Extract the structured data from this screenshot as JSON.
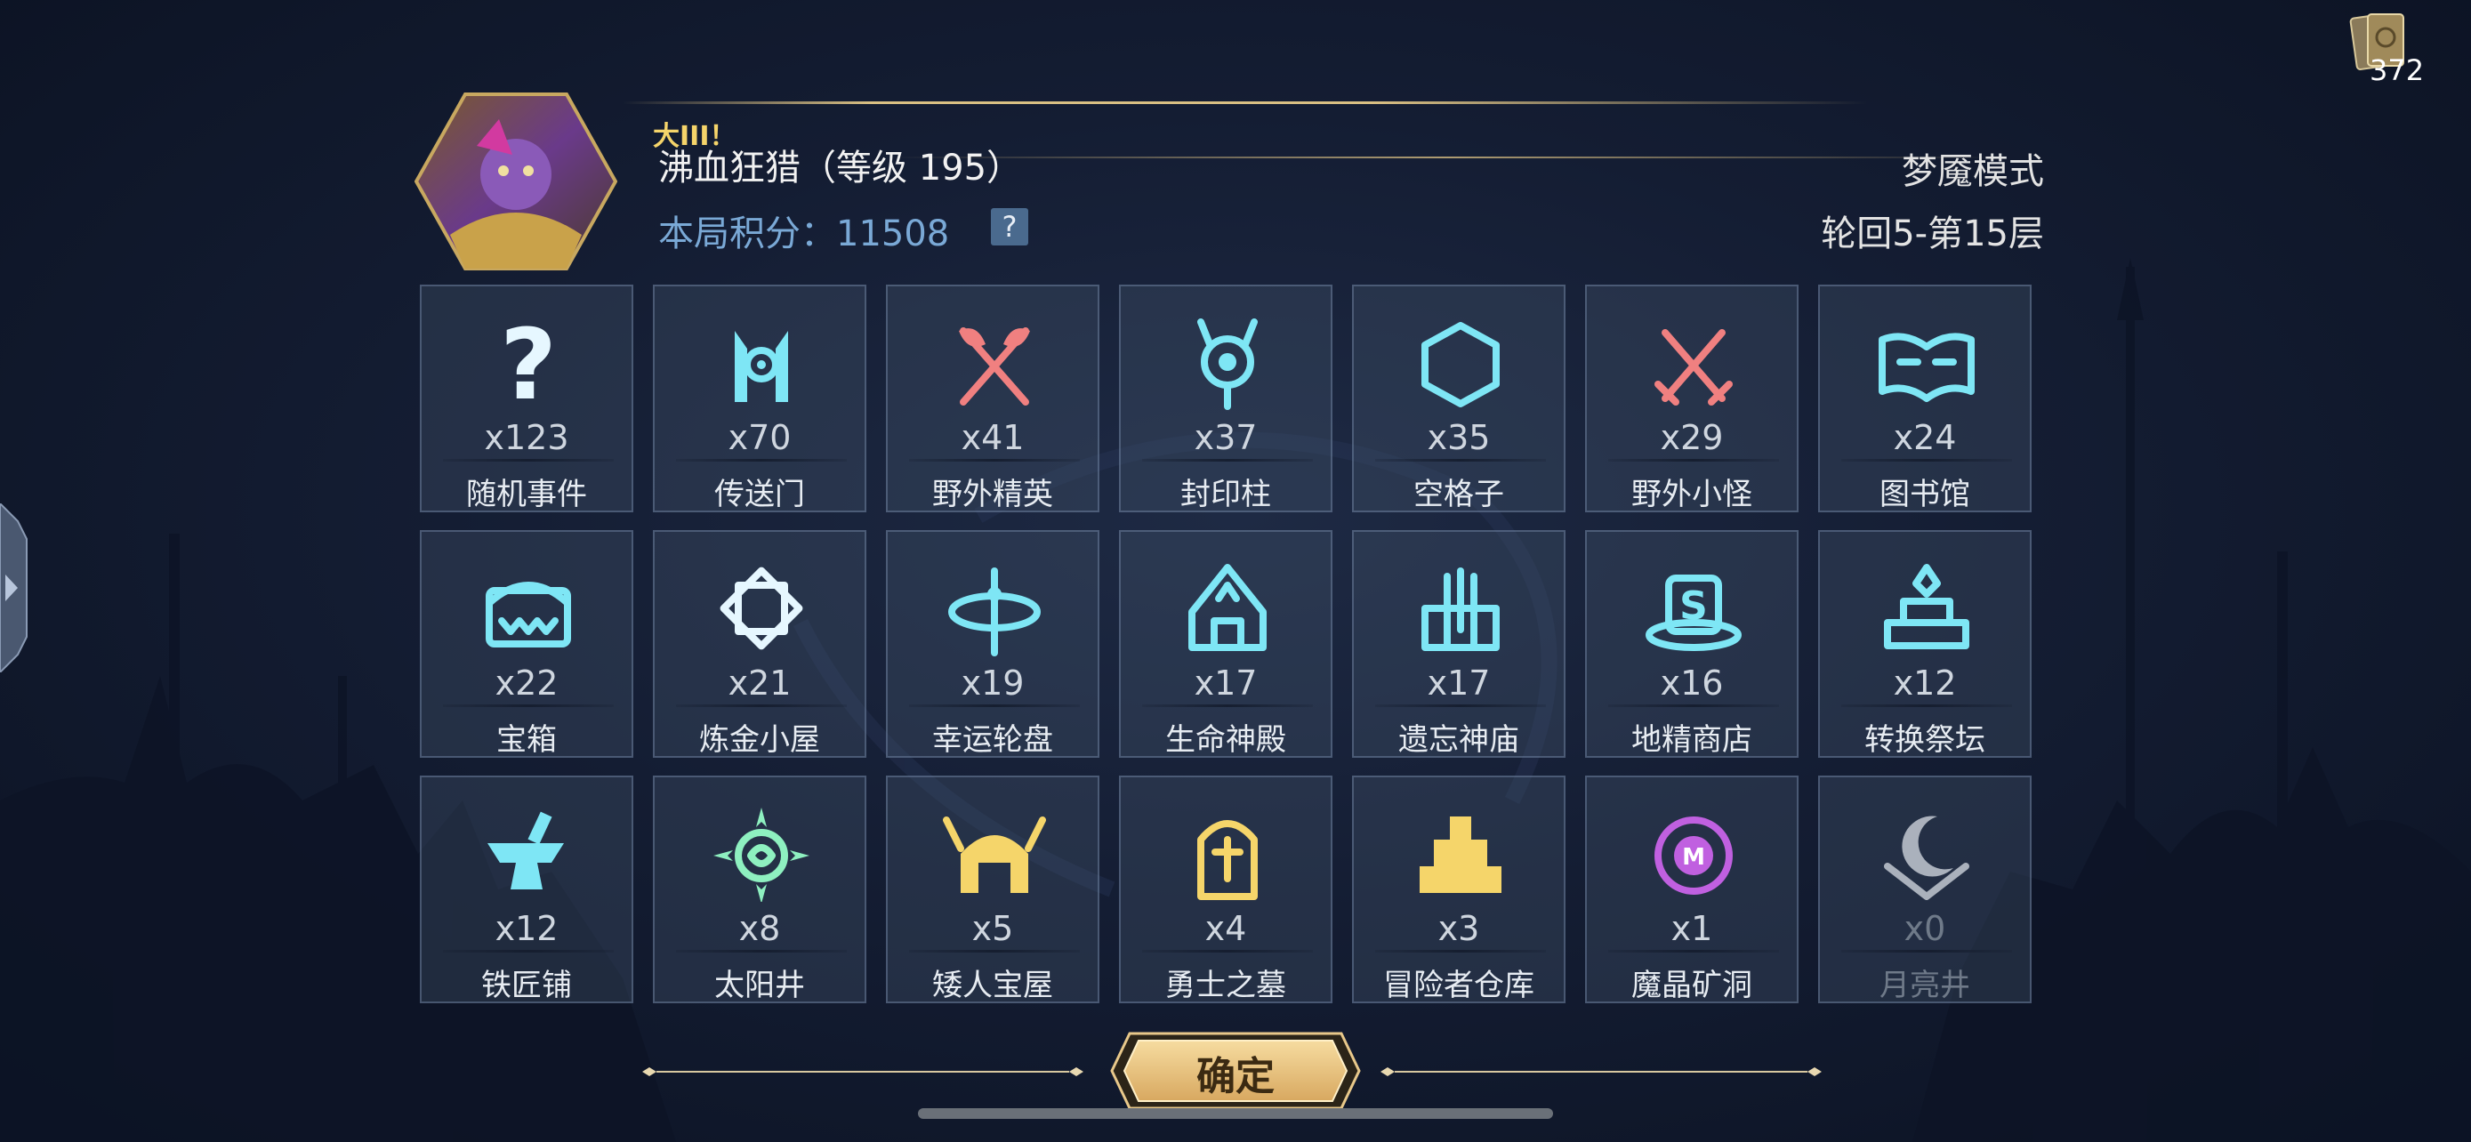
{
  "header": {
    "title_badge": "大III！",
    "player_name": "沸血狂猎（等级 195）",
    "score_label": "本局积分：",
    "score_value": "11508",
    "help_label": "?",
    "mode": "梦魇模式",
    "floor": "轮回5-第15层"
  },
  "cards": {
    "count": "372",
    "icon": "card-deck-icon"
  },
  "grid": {
    "rows": [
      [
        {
          "count": "x123",
          "label": "随机事件",
          "icon": "question-mark-icon",
          "color": "#e6f7ff"
        },
        {
          "count": "x70",
          "label": "传送门",
          "icon": "portal-icon",
          "color": "#7ee6f5"
        },
        {
          "count": "x41",
          "label": "野外精英",
          "icon": "crossed-axes-icon",
          "color": "#f08080"
        },
        {
          "count": "x37",
          "label": "封印柱",
          "icon": "seal-pillar-icon",
          "color": "#7ee6f5"
        },
        {
          "count": "x35",
          "label": "空格子",
          "icon": "hexagon-icon",
          "color": "#7ee6f5"
        },
        {
          "count": "x29",
          "label": "野外小怪",
          "icon": "crossed-swords-icon",
          "color": "#f08080"
        },
        {
          "count": "x24",
          "label": "图书馆",
          "icon": "open-book-icon",
          "color": "#7ee6f5"
        }
      ],
      [
        {
          "count": "x22",
          "label": "宝箱",
          "icon": "treasure-chest-icon",
          "color": "#7ee6f5"
        },
        {
          "count": "x21",
          "label": "炼金小屋",
          "icon": "alchemy-frame-icon",
          "color": "#e6f7ff"
        },
        {
          "count": "x19",
          "label": "幸运轮盘",
          "icon": "lucky-wheel-icon",
          "color": "#7ee6f5"
        },
        {
          "count": "x17",
          "label": "生命神殿",
          "icon": "life-temple-icon",
          "color": "#7ee6f5"
        },
        {
          "count": "x17",
          "label": "遗忘神庙",
          "icon": "forgotten-temple-icon",
          "color": "#7ee6f5"
        },
        {
          "count": "x16",
          "label": "地精商店",
          "icon": "goblin-shop-icon",
          "color": "#7ee6f5"
        },
        {
          "count": "x12",
          "label": "转换祭坛",
          "icon": "conversion-altar-icon",
          "color": "#7ee6f5"
        }
      ],
      [
        {
          "count": "x12",
          "label": "铁匠铺",
          "icon": "anvil-icon",
          "color": "#7ee6f5"
        },
        {
          "count": "x8",
          "label": "太阳井",
          "icon": "sun-well-icon",
          "color": "#8ef0c0"
        },
        {
          "count": "x5",
          "label": "矮人宝屋",
          "icon": "dwarf-helmet-icon",
          "color": "#f5d56a"
        },
        {
          "count": "x4",
          "label": "勇士之墓",
          "icon": "tombstone-icon",
          "color": "#f5d56a"
        },
        {
          "count": "x3",
          "label": "冒险者仓库",
          "icon": "adventurer-vault-icon",
          "color": "#f5d56a"
        },
        {
          "count": "x1",
          "label": "魔晶矿洞",
          "icon": "crystal-mine-icon",
          "color": "#c060e0"
        },
        {
          "count": "x0",
          "label": "月亮井",
          "icon": "moon-well-icon",
          "color": "#d8dde4",
          "dim": true
        }
      ]
    ]
  },
  "confirm_label": "确定"
}
